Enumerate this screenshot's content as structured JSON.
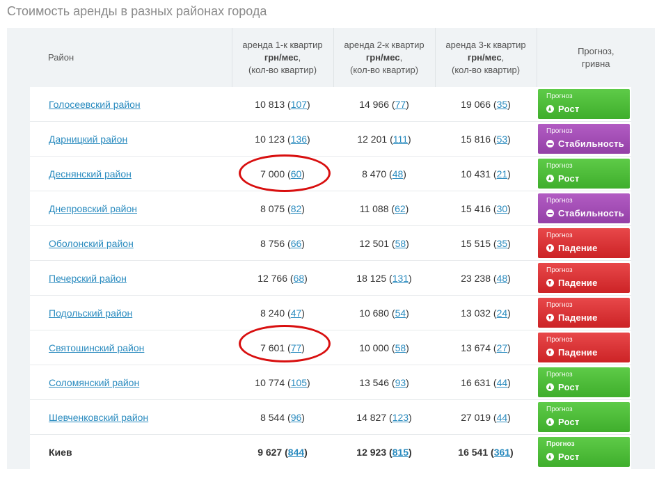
{
  "page_title": "Стоимость аренды в разных районах города",
  "columns": {
    "district": "Район",
    "one_room": {
      "line1": "аренда 1-к квартир",
      "line2": "грн/мес",
      "line2_suffix": ",",
      "line3": "(кол-во квартир)"
    },
    "two_room": {
      "line1": "аренда 2-к квартир",
      "line2": "грн/мес",
      "line2_suffix": ",",
      "line3": "(кол-во квартир)"
    },
    "three_room": {
      "line1": "аренда 3-к квартир",
      "line2": "грн/мес",
      "line2_suffix": ",",
      "line3": "(кол-во квартир)"
    },
    "forecast": {
      "line1": "Прогноз,",
      "line2": "гривна"
    }
  },
  "forecast_title": "Прогноз",
  "rows": [
    {
      "district": "Голосеевский район",
      "p1": "10 813",
      "c1": "107",
      "p2": "14 966",
      "c2": "77",
      "p3": "19 066",
      "c3": "35",
      "forecast": "Рост",
      "trend": "up",
      "color": "#4cbc38"
    },
    {
      "district": "Дарницкий район",
      "p1": "10 123",
      "c1": "136",
      "p2": "12 201",
      "c2": "111",
      "p3": "15 816",
      "c3": "53",
      "forecast": "Стабильность",
      "trend": "flat",
      "color": "#a34db5"
    },
    {
      "district": "Деснянский район",
      "p1": "7 000",
      "c1": "60",
      "p2": "8 470",
      "c2": "48",
      "p3": "10 431",
      "c3": "21",
      "forecast": "Рост",
      "trend": "up",
      "color": "#4cbc38"
    },
    {
      "district": "Днепровский район",
      "p1": "8 075",
      "c1": "82",
      "p2": "11 088",
      "c2": "62",
      "p3": "15 416",
      "c3": "30",
      "forecast": "Стабильность",
      "trend": "flat",
      "color": "#a34db5"
    },
    {
      "district": "Оболонский район",
      "p1": "8 756",
      "c1": "66",
      "p2": "12 501",
      "c2": "58",
      "p3": "15 515",
      "c3": "35",
      "forecast": "Падение",
      "trend": "down",
      "color": "#d93537"
    },
    {
      "district": "Печерский район",
      "p1": "12 766",
      "c1": "68",
      "p2": "18 125",
      "c2": "131",
      "p3": "23 238",
      "c3": "48",
      "forecast": "Падение",
      "trend": "down",
      "color": "#d93537"
    },
    {
      "district": "Подольский район",
      "p1": "8 240",
      "c1": "47",
      "p2": "10 680",
      "c2": "54",
      "p3": "13 032",
      "c3": "24",
      "forecast": "Падение",
      "trend": "down",
      "color": "#d93537"
    },
    {
      "district": "Святошинский район",
      "p1": "7 601",
      "c1": "77",
      "p2": "10 000",
      "c2": "58",
      "p3": "13 674",
      "c3": "27",
      "forecast": "Падение",
      "trend": "down",
      "color": "#d93537"
    },
    {
      "district": "Соломянский район",
      "p1": "10 774",
      "c1": "105",
      "p2": "13 546",
      "c2": "93",
      "p3": "16 631",
      "c3": "44",
      "forecast": "Рост",
      "trend": "up",
      "color": "#4cbc38"
    },
    {
      "district": "Шевченковский район",
      "p1": "8 544",
      "c1": "96",
      "p2": "14 827",
      "c2": "123",
      "p3": "27 019",
      "c3": "44",
      "forecast": "Рост",
      "trend": "up",
      "color": "#4cbc38"
    }
  ],
  "total": {
    "district": "Киев",
    "p1": "9 627",
    "c1": "844",
    "p2": "12 923",
    "c2": "815",
    "p3": "16 541",
    "c3": "361",
    "forecast": "Рост",
    "trend": "up",
    "color": "#4cbc38"
  },
  "annotation_color": "#d80f0f"
}
